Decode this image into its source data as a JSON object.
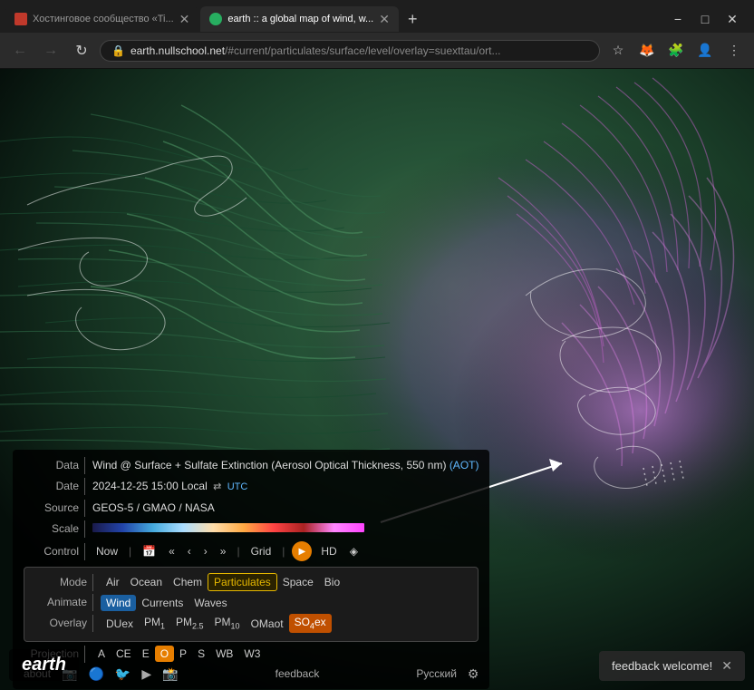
{
  "browser": {
    "tabs": [
      {
        "id": "tab1",
        "title": "Хостинговое сообщество «Ti...",
        "active": false,
        "favicon": "red"
      },
      {
        "id": "tab2",
        "title": "earth :: a global map of wind, w...",
        "active": true,
        "favicon": "teal"
      }
    ],
    "tab_add_label": "+",
    "window_controls": [
      "−",
      "□",
      "✕"
    ],
    "url": "earth.nullschool.net",
    "url_path": "/#current/particulates/surface/level/overlay=suexttau/ort...",
    "nav": {
      "back": "←",
      "forward": "→",
      "reload": "↻"
    }
  },
  "panel": {
    "data_label": "Data",
    "data_value": "Wind @ Surface + Sulfate Extinction (Aerosol Optical Thickness, 550 nm)",
    "data_aot": "(AOT)",
    "date_label": "Date",
    "date_value": "2024-12-25 15:00 Local",
    "utc_label": "UTC",
    "source_label": "Source",
    "source_value": "GEOS-5 / GMAO / NASA",
    "scale_label": "Scale",
    "control_label": "Control",
    "control_now": "Now",
    "control_grid": "Grid",
    "control_hd": "HD",
    "mode_label": "Mode",
    "modes": [
      "Air",
      "Ocean",
      "Chem",
      "Particulates",
      "Space",
      "Bio"
    ],
    "active_mode": "Particulates",
    "animate_label": "Animate",
    "animate_items": [
      "Wind",
      "Currents",
      "Waves"
    ],
    "active_animate": "Wind",
    "overlay_label": "Overlay",
    "overlay_items": [
      "DUex",
      "PM₁",
      "PM₂.₅",
      "PM₁₀",
      "OMaot",
      "SO₄ex"
    ],
    "active_overlay": "SO₄ex",
    "projection_label": "Projection",
    "projections": [
      "A",
      "CE",
      "E",
      "O",
      "P",
      "S",
      "WB",
      "W3"
    ],
    "active_projection": "O",
    "footer": {
      "about": "about",
      "feedback": "feedback",
      "russian": "Русский"
    }
  },
  "earth_badge": "earth",
  "feedback_toast": "feedback welcome!",
  "toast_close": "✕"
}
